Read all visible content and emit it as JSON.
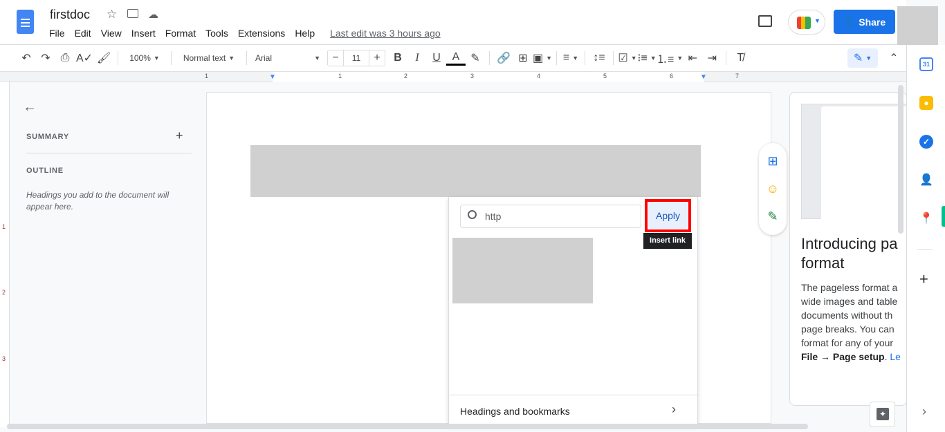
{
  "doc": {
    "title": "firstdoc",
    "last_edit": "Last edit was 3 hours ago"
  },
  "menu": [
    "File",
    "Edit",
    "View",
    "Insert",
    "Format",
    "Tools",
    "Extensions",
    "Help"
  ],
  "header": {
    "share_label": "Share"
  },
  "toolbar": {
    "zoom": "100%",
    "style": "Normal text",
    "font": "Arial",
    "font_size": "11",
    "minus": "−",
    "plus": "+"
  },
  "ruler": {
    "h_ticks": [
      "1",
      "1",
      "2",
      "3",
      "4",
      "5",
      "6",
      "7"
    ],
    "v_ticks": [
      "1",
      "2",
      "3"
    ]
  },
  "outline": {
    "summary": "SUMMARY",
    "outline": "OUTLINE",
    "hint": "Headings you add to the document will appear here."
  },
  "link_dialog": {
    "input_value": "http",
    "apply_label": "Apply",
    "tooltip": "Insert link",
    "headings_label": "Headings and bookmarks"
  },
  "card": {
    "title": "Introducing pa format",
    "body": "The pageless format a wide images and table documents without th page breaks. You can format for any of your",
    "bold_text": "File → Page setup",
    "link_text": "Le"
  },
  "colors": {
    "accent": "#1a73e8",
    "highlight_border": "#ff0000",
    "tooltip_bg": "#202124"
  }
}
